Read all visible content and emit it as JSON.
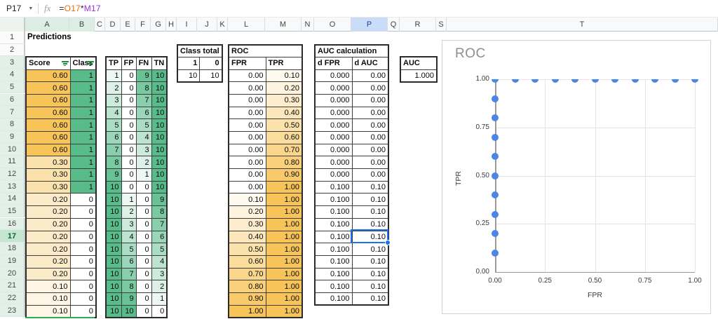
{
  "toolbar": {
    "name_box": "P17",
    "fx_label": "fx",
    "formula_parts": [
      {
        "text": "=",
        "color": "#202124"
      },
      {
        "text": "O17",
        "color": "#e8710a"
      },
      {
        "text": "*",
        "color": "#202124"
      },
      {
        "text": "M17",
        "color": "#9334e6"
      }
    ]
  },
  "columns": [
    "A",
    "B",
    "C",
    "D",
    "E",
    "F",
    "G",
    "H",
    "I",
    "J",
    "K",
    "L",
    "M",
    "N",
    "O",
    "P",
    "Q",
    "R",
    "S",
    "T"
  ],
  "rows": [
    1,
    2,
    3,
    4,
    5,
    6,
    7,
    8,
    9,
    10,
    11,
    12,
    13,
    14,
    15,
    16,
    17,
    18,
    19,
    20,
    21,
    22,
    23
  ],
  "selection": {
    "cell": "P17",
    "column": "P",
    "row": 17,
    "filter_columns": [
      "A",
      "B"
    ],
    "filter_row_start": 3,
    "filter_row_end": 23
  },
  "sheet": {
    "predictions_label": "Predictions",
    "score_table": {
      "headers": [
        "Score",
        "Class"
      ],
      "rows": [
        [
          "0.60",
          "1"
        ],
        [
          "0.60",
          "1"
        ],
        [
          "0.60",
          "1"
        ],
        [
          "0.60",
          "1"
        ],
        [
          "0.60",
          "1"
        ],
        [
          "0.60",
          "1"
        ],
        [
          "0.60",
          "1"
        ],
        [
          "0.30",
          "1"
        ],
        [
          "0.30",
          "1"
        ],
        [
          "0.30",
          "1"
        ],
        [
          "0.20",
          "0"
        ],
        [
          "0.20",
          "0"
        ],
        [
          "0.20",
          "0"
        ],
        [
          "0.20",
          "0"
        ],
        [
          "0.20",
          "0"
        ],
        [
          "0.20",
          "0"
        ],
        [
          "0.20",
          "0"
        ],
        [
          "0.10",
          "0"
        ],
        [
          "0.10",
          "0"
        ],
        [
          "0.10",
          "0"
        ]
      ]
    },
    "confusion_table": {
      "headers": [
        "TP",
        "FP",
        "FN",
        "TN"
      ],
      "rows": [
        [
          "1",
          "0",
          "9",
          "10"
        ],
        [
          "2",
          "0",
          "8",
          "10"
        ],
        [
          "3",
          "0",
          "7",
          "10"
        ],
        [
          "4",
          "0",
          "6",
          "10"
        ],
        [
          "5",
          "0",
          "5",
          "10"
        ],
        [
          "6",
          "0",
          "4",
          "10"
        ],
        [
          "7",
          "0",
          "3",
          "10"
        ],
        [
          "8",
          "0",
          "2",
          "10"
        ],
        [
          "9",
          "0",
          "1",
          "10"
        ],
        [
          "10",
          "0",
          "0",
          "10"
        ],
        [
          "10",
          "1",
          "0",
          "9"
        ],
        [
          "10",
          "2",
          "0",
          "8"
        ],
        [
          "10",
          "3",
          "0",
          "7"
        ],
        [
          "10",
          "4",
          "0",
          "6"
        ],
        [
          "10",
          "5",
          "0",
          "5"
        ],
        [
          "10",
          "6",
          "0",
          "4"
        ],
        [
          "10",
          "7",
          "0",
          "3"
        ],
        [
          "10",
          "8",
          "0",
          "2"
        ],
        [
          "10",
          "9",
          "0",
          "1"
        ],
        [
          "10",
          "10",
          "0",
          "0"
        ]
      ]
    },
    "class_total": {
      "title": "Class total",
      "headers": [
        "1",
        "0"
      ],
      "values": [
        "10",
        "10"
      ]
    },
    "roc_table": {
      "title": "ROC",
      "headers": [
        "FPR",
        "TPR"
      ],
      "rows": [
        [
          "0.00",
          "0.10"
        ],
        [
          "0.00",
          "0.20"
        ],
        [
          "0.00",
          "0.30"
        ],
        [
          "0.00",
          "0.40"
        ],
        [
          "0.00",
          "0.50"
        ],
        [
          "0.00",
          "0.60"
        ],
        [
          "0.00",
          "0.70"
        ],
        [
          "0.00",
          "0.80"
        ],
        [
          "0.00",
          "0.90"
        ],
        [
          "0.00",
          "1.00"
        ],
        [
          "0.10",
          "1.00"
        ],
        [
          "0.20",
          "1.00"
        ],
        [
          "0.30",
          "1.00"
        ],
        [
          "0.40",
          "1.00"
        ],
        [
          "0.50",
          "1.00"
        ],
        [
          "0.60",
          "1.00"
        ],
        [
          "0.70",
          "1.00"
        ],
        [
          "0.80",
          "1.00"
        ],
        [
          "0.90",
          "1.00"
        ],
        [
          "1.00",
          "1.00"
        ]
      ]
    },
    "auc_table": {
      "title": "AUC calculation",
      "headers": [
        "d FPR",
        "d AUC"
      ],
      "rows": [
        [
          "0.000",
          "0.00"
        ],
        [
          "0.000",
          "0.00"
        ],
        [
          "0.000",
          "0.00"
        ],
        [
          "0.000",
          "0.00"
        ],
        [
          "0.000",
          "0.00"
        ],
        [
          "0.000",
          "0.00"
        ],
        [
          "0.000",
          "0.00"
        ],
        [
          "0.000",
          "0.00"
        ],
        [
          "0.000",
          "0.00"
        ],
        [
          "0.100",
          "0.10"
        ],
        [
          "0.100",
          "0.10"
        ],
        [
          "0.100",
          "0.10"
        ],
        [
          "0.100",
          "0.10"
        ],
        [
          "0.100",
          "0.10"
        ],
        [
          "0.100",
          "0.10"
        ],
        [
          "0.100",
          "0.10"
        ],
        [
          "0.100",
          "0.10"
        ],
        [
          "0.100",
          "0.10"
        ],
        [
          "0.100",
          "0.10"
        ]
      ]
    },
    "auc_box": {
      "label": "AUC",
      "value": "1.000"
    }
  },
  "colors": {
    "scale_orange_max": "#f7c45a",
    "scale_green_max": "#57bb8a",
    "selection_blue": "#1a73e8",
    "filter_green": "#1e8e3e",
    "chart_point_blue": "#4a86e8"
  },
  "chart_data": {
    "type": "scatter",
    "title": "ROC",
    "xlabel": "FPR",
    "ylabel": "TPR",
    "xlim": [
      0,
      1
    ],
    "ylim": [
      0,
      1
    ],
    "grid": true,
    "legend": "none",
    "xticks": [
      "0.00",
      "0.25",
      "0.50",
      "0.75",
      "1.00"
    ],
    "yticks": [
      "1.00",
      "0.75",
      "0.50",
      "0.25",
      "0.00"
    ],
    "points": [
      [
        0.0,
        0.1
      ],
      [
        0.0,
        0.2
      ],
      [
        0.0,
        0.3
      ],
      [
        0.0,
        0.4
      ],
      [
        0.0,
        0.5
      ],
      [
        0.0,
        0.6
      ],
      [
        0.0,
        0.7
      ],
      [
        0.0,
        0.8
      ],
      [
        0.0,
        0.9
      ],
      [
        0.0,
        1.0
      ],
      [
        0.1,
        1.0
      ],
      [
        0.2,
        1.0
      ],
      [
        0.3,
        1.0
      ],
      [
        0.4,
        1.0
      ],
      [
        0.5,
        1.0
      ],
      [
        0.6,
        1.0
      ],
      [
        0.7,
        1.0
      ],
      [
        0.8,
        1.0
      ],
      [
        0.9,
        1.0
      ],
      [
        1.0,
        1.0
      ]
    ]
  }
}
